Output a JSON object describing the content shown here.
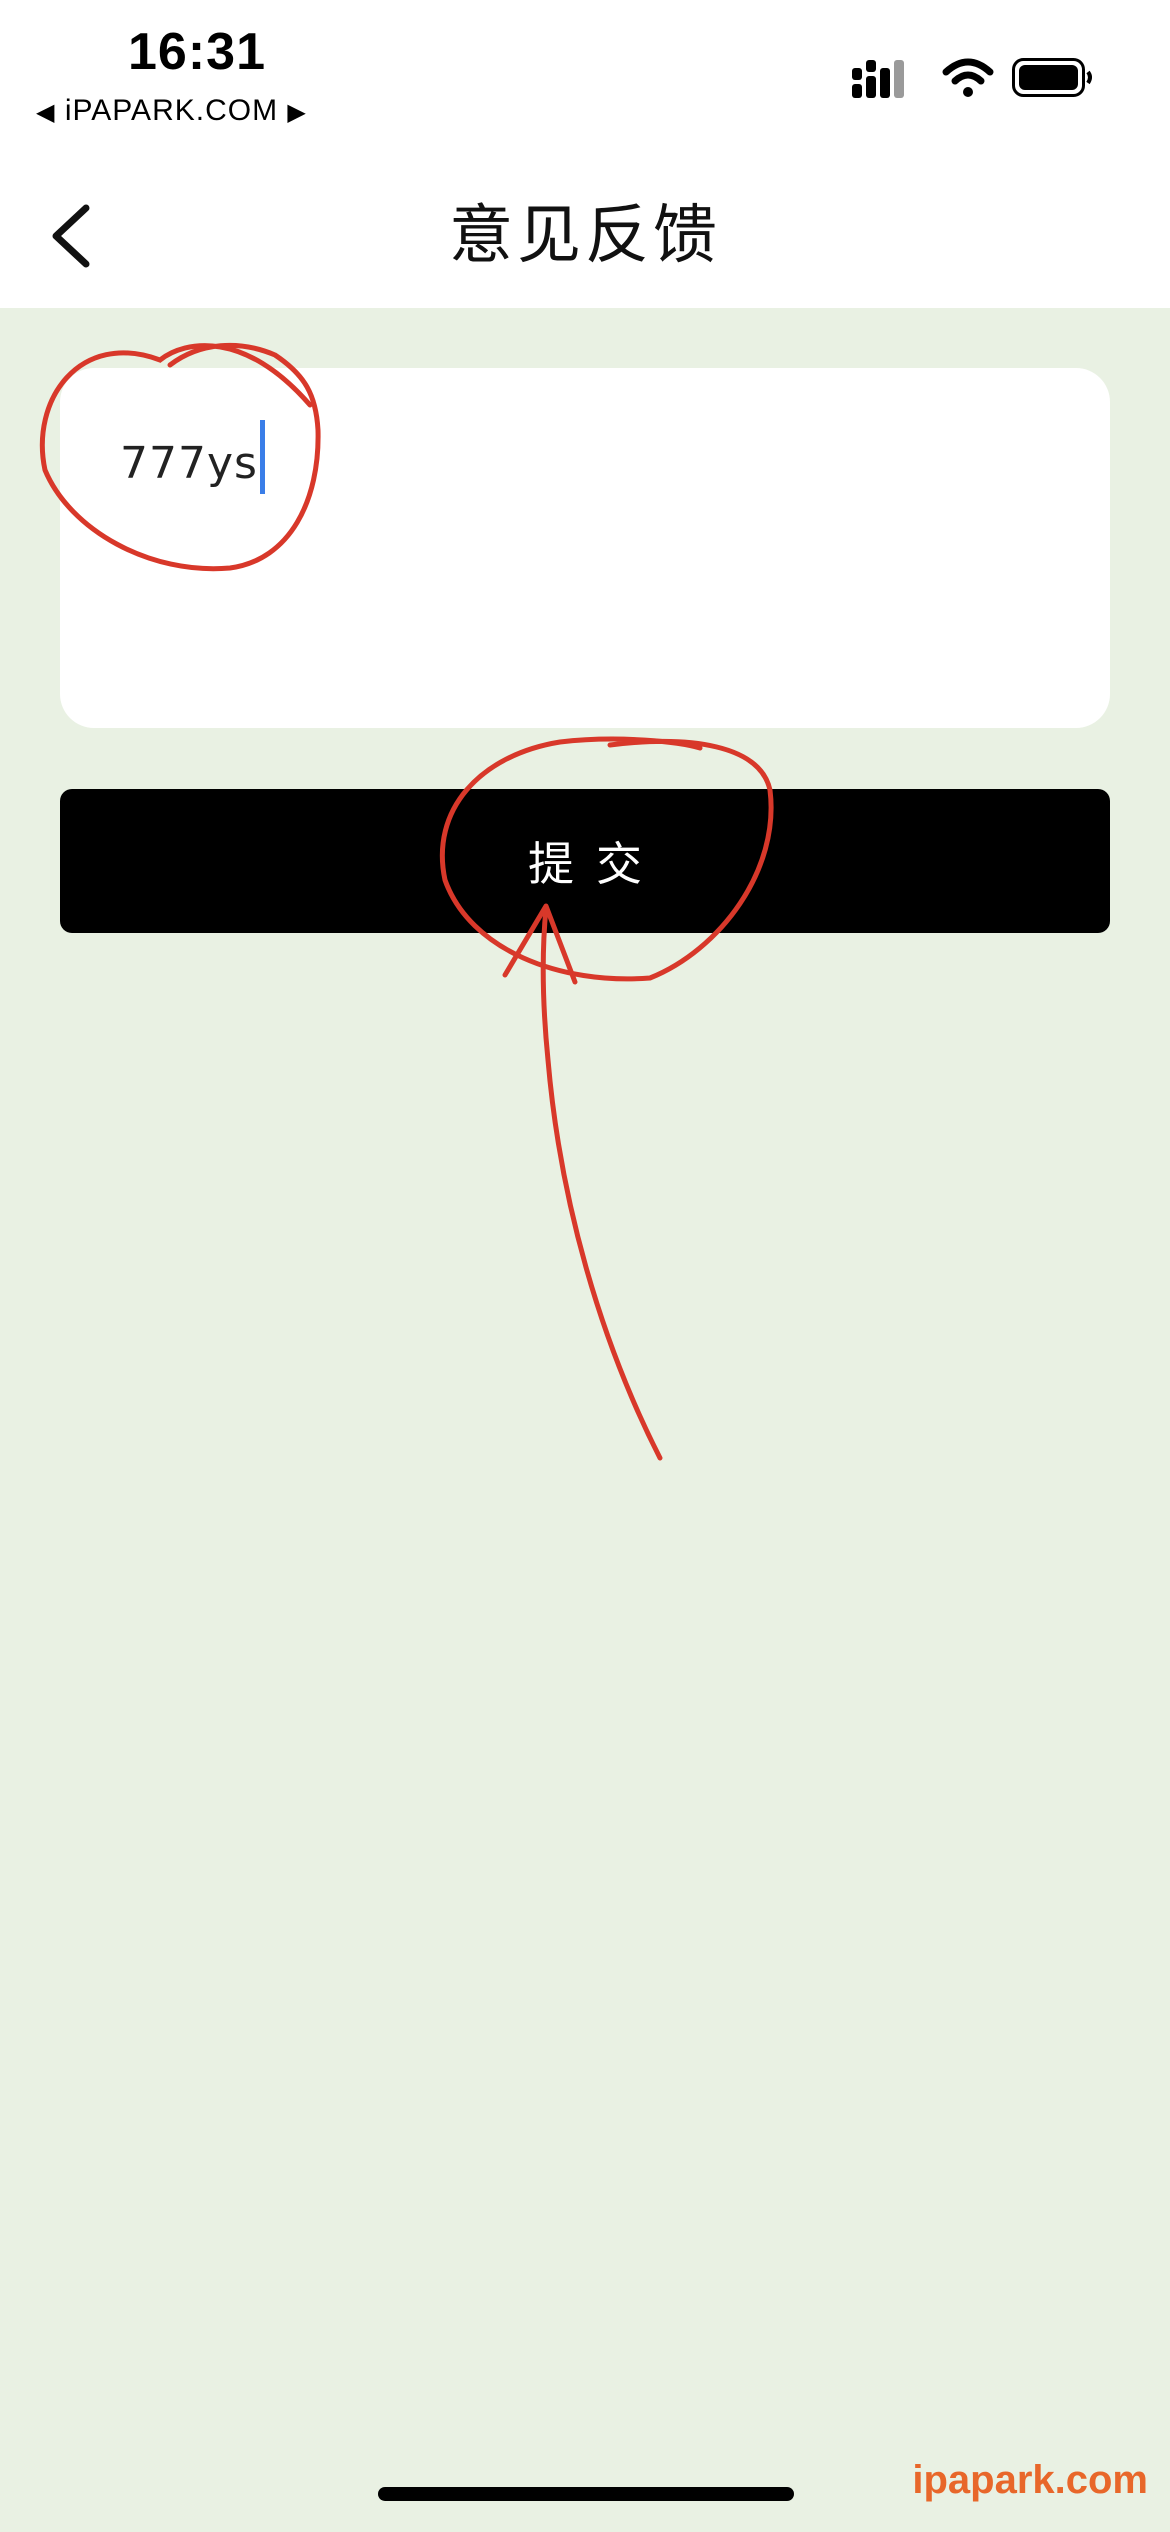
{
  "status_bar": {
    "time": "16:31",
    "back_app_arrow": "◀",
    "back_app_label": "iPAPARK.COM",
    "back_app_forward": "▶",
    "signal_icon": "signal-bars-icon",
    "wifi_icon": "wifi-icon",
    "battery_icon": "battery-icon"
  },
  "nav": {
    "title": "意见反馈",
    "back_icon": "chevron-left-icon"
  },
  "feedback": {
    "value": "777ys"
  },
  "submit": {
    "label": "提交"
  },
  "annotation_color": "#d8382a",
  "watermark": "ipapark.com",
  "colors": {
    "background": "#e9f1e3",
    "button": "#000000",
    "caret": "#3a7ee8",
    "watermark": "#e8672a"
  }
}
